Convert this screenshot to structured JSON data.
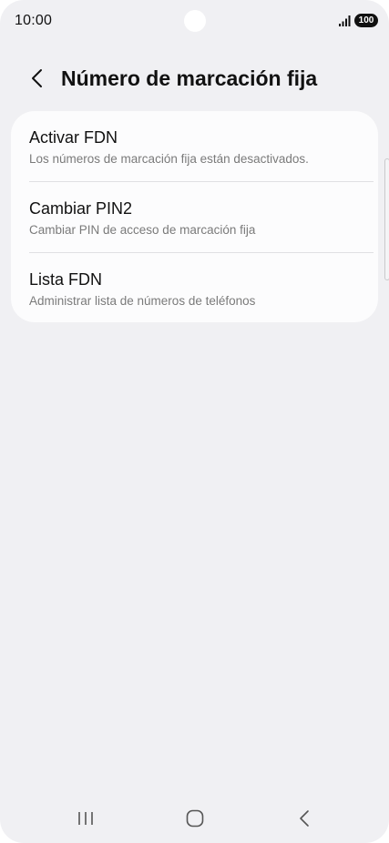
{
  "status_bar": {
    "time": "10:00",
    "battery": "100",
    "signal_icon": "signal-icon"
  },
  "header": {
    "back_icon": "chevron-left-icon",
    "title": "Número de marcación fija"
  },
  "settings": {
    "items": [
      {
        "title": "Activar FDN",
        "subtitle": "Los números de marcación fija están desactivados."
      },
      {
        "title": "Cambiar PIN2",
        "subtitle": "Cambiar PIN de acceso de marcación fija"
      },
      {
        "title": "Lista FDN",
        "subtitle": "Administrar lista de números de teléfonos"
      }
    ]
  },
  "nav_bar": {
    "recents_icon": "recents-icon",
    "home_icon": "home-icon",
    "back_icon": "back-icon"
  },
  "colors": {
    "background": "#f0f0f3",
    "card": "#fcfcfd",
    "title_text": "#111111",
    "subtitle_text": "#7a7a7a"
  }
}
